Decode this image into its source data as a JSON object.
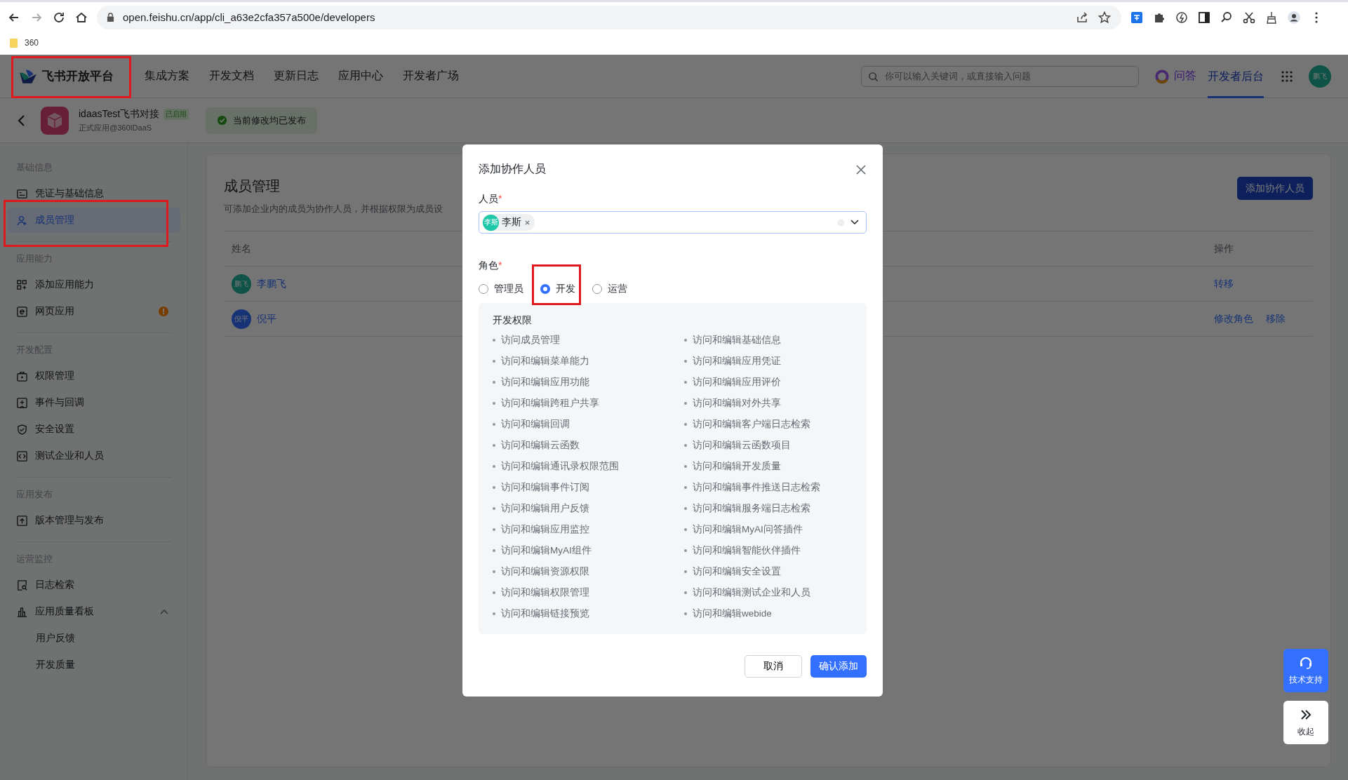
{
  "browser": {
    "url": "open.feishu.cn/app/cli_a63e2cfa357a500e/developers",
    "bookmarks": [
      "360"
    ]
  },
  "header": {
    "logo": {
      "text": "飞书开放平台",
      "highlighted": true
    },
    "nav": [
      "集成方案",
      "开发文档",
      "更新日志",
      "应用中心",
      "开发者广场"
    ],
    "search": {
      "placeholder": "你可以输入关键词，或直接输入问题"
    },
    "qa": "问答",
    "console": {
      "label": "开发者后台",
      "selected": true
    },
    "avatar": "鹏飞"
  },
  "app_bar": {
    "name": "idaasTest飞书对接",
    "badge": "已启用",
    "subtitle": "正式应用@360IDaaS",
    "status": "当前修改均已发布"
  },
  "sidebar": {
    "sections": [
      {
        "title": "基础信息",
        "items": [
          {
            "label": "凭证与基础信息",
            "selected": false
          },
          {
            "label": "成员管理",
            "selected": true,
            "highlighted": true
          }
        ]
      },
      {
        "title": "应用能力",
        "items": [
          {
            "label": "添加应用能力",
            "selected": false
          },
          {
            "label": "网页应用",
            "selected": false,
            "alert": true
          }
        ]
      },
      {
        "title": "开发配置",
        "items": [
          {
            "label": "权限管理",
            "selected": false
          },
          {
            "label": "事件与回调",
            "selected": false
          },
          {
            "label": "安全设置",
            "selected": false
          },
          {
            "label": "测试企业和人员",
            "selected": false
          }
        ]
      },
      {
        "title": "应用发布",
        "items": [
          {
            "label": "版本管理与发布",
            "selected": false
          }
        ]
      },
      {
        "title": "运营监控",
        "items": [
          {
            "label": "日志检索",
            "selected": false
          },
          {
            "label": "应用质量看板",
            "selected": false,
            "expanded": true,
            "children": [
              {
                "label": "用户反馈",
                "selected": false
              },
              {
                "label": "开发质量",
                "selected": false
              }
            ]
          }
        ]
      }
    ]
  },
  "main": {
    "title": "成员管理",
    "description": "可添加企业内的成员为协作人员，并根据权限为成员设",
    "add_button": "添加协作人员",
    "columns": [
      "姓名",
      "操作"
    ],
    "rows": [
      {
        "name": "李鹏飞",
        "avatar": "鹏飞",
        "actions": [
          "转移"
        ]
      },
      {
        "name": "倪平",
        "avatar": "倪平",
        "actions": [
          "修改角色",
          "移除"
        ]
      }
    ]
  },
  "modal": {
    "title": "添加协作人员",
    "person_label": "人员",
    "person_required": "*",
    "selected_person": {
      "name": "李斯",
      "avatar": "李斯"
    },
    "role_label": "角色",
    "role_required": "*",
    "roles": [
      {
        "label": "管理员",
        "selected": false
      },
      {
        "label": "开发",
        "selected": true,
        "highlighted": true
      },
      {
        "label": "运营",
        "selected": false
      }
    ],
    "permissions_title": "开发权限",
    "permissions": [
      "访问成员管理",
      "访问和编辑基础信息",
      "访问和编辑菜单能力",
      "访问和编辑应用凭证",
      "访问和编辑应用功能",
      "访问和编辑应用评价",
      "访问和编辑跨租户共享",
      "访问和编辑对外共享",
      "访问和编辑回调",
      "访问和编辑客户端日志检索",
      "访问和编辑云函数",
      "访问和编辑云函数项目",
      "访问和编辑通讯录权限范围",
      "访问和编辑开发质量",
      "访问和编辑事件订阅",
      "访问和编辑事件推送日志检索",
      "访问和编辑用户反馈",
      "访问和编辑服务端日志检索",
      "访问和编辑应用监控",
      "访问和编辑MyAI问答插件",
      "访问和编辑MyAI组件",
      "访问和编辑智能伙伴插件",
      "访问和编辑资源权限",
      "访问和编辑安全设置",
      "访问和编辑权限管理",
      "访问和编辑测试企业和人员",
      "访问和编辑链接预览",
      "访问和编辑webide"
    ],
    "cancel": "取消",
    "confirm": "确认添加"
  },
  "floating": {
    "support": "技术支持",
    "collapse": "收起"
  }
}
